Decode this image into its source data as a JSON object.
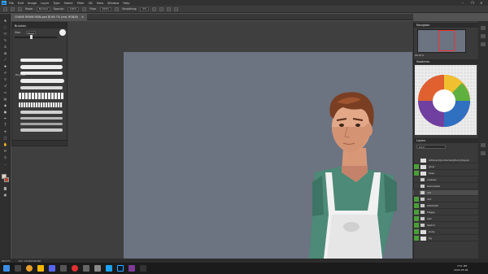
{
  "app": {
    "logo": "Ps",
    "menu": [
      "File",
      "Edit",
      "Image",
      "Layer",
      "Type",
      "Select",
      "Filter",
      "3D",
      "View",
      "Window",
      "Help"
    ],
    "window_controls": [
      "–",
      "❐",
      "✕"
    ]
  },
  "options_bar": {
    "mode_label": "Mode:",
    "mode_value": "Normal",
    "opacity_label": "Opacity:",
    "opacity_value": "100%",
    "flow_label": "Flow:",
    "flow_value": "100%",
    "smoothing_label": "Smoothing:",
    "smoothing_value": "0%"
  },
  "document_tab": {
    "title": "CHANE REWN REIN.psd @ 66.7% (red, RGB/8)",
    "close": "×"
  },
  "brushes_panel": {
    "title": "Brushes",
    "size_label": "Size:",
    "size_value": "33 px",
    "group_label": "Brushes"
  },
  "navigator": {
    "title": "Navigator",
    "zoom": "66.67%"
  },
  "swatches": {
    "title": "Swatches"
  },
  "layers": {
    "title": "Layers",
    "filter_label": "Kind",
    "rows": [
      {
        "name": "Artboard/(protected)(tum)/(layer)",
        "visible": false
      },
      {
        "name": "glow",
        "visible": true
      },
      {
        "name": "base",
        "visible": true
      },
      {
        "name": "creases",
        "visible": false
      },
      {
        "name": "backshade",
        "visible": false
      },
      {
        "name": "red",
        "visible": false
      },
      {
        "name": "dirt",
        "visible": true
      },
      {
        "name": "SHADOW",
        "visible": true
      },
      {
        "name": "Flaggs",
        "visible": true
      },
      {
        "name": "skin",
        "visible": true
      },
      {
        "name": "Sketch",
        "visible": true
      },
      {
        "name": "body",
        "visible": true
      },
      {
        "name": "bg",
        "visible": true
      }
    ]
  },
  "status_bar": {
    "zoom": "66.67%",
    "doc_info": "Doc: 16.5M/198.6M"
  },
  "taskbar": {
    "time": "3:51 PM",
    "date": "2022-05-06"
  },
  "colors": {
    "canvas_bg": "#6c7381",
    "foreground_color": "#e7d3c4",
    "background_color": "#b04a2c"
  }
}
